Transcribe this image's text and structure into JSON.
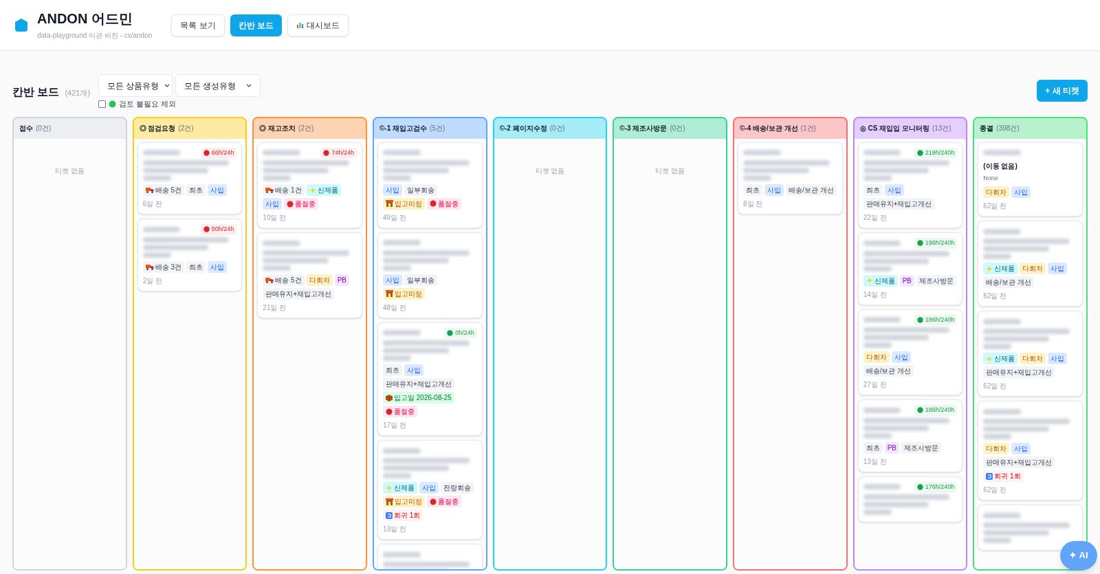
{
  "app": {
    "title": "ANDON 어드민",
    "subtitle": "data-playground 이관 버전 - cx/andon"
  },
  "nav": [
    {
      "label": "목록 보기",
      "selected": false,
      "kind": "list"
    },
    {
      "label": "칸반 보드",
      "selected": true,
      "kind": "board"
    },
    {
      "label": "대시보드",
      "selected": false,
      "kind": "dashboard"
    }
  ],
  "toolbar": {
    "title": "칸반 보드",
    "count": "(421개)",
    "filters": [
      "모든 상품유형",
      "모든 생성유형"
    ],
    "exclude": {
      "label": "검토 불필요 제외",
      "checked": false
    },
    "new_button": "+ 새 티켓"
  },
  "columns": [
    {
      "title": "접수",
      "count": "(0건)",
      "color": "#d1d5db",
      "empty": "티켓 없음"
    },
    {
      "title": "◎ 점검요청",
      "count": "(2건)",
      "color": "#facc15",
      "cards": [
        {
          "kind": "ticket",
          "sla": {
            "text": "66h/24h",
            "color": "#dc2626"
          },
          "tags": [
            {
              "text": "배송 5건",
              "kind": "delivery"
            },
            {
              "text": "최초",
              "kind": "plain"
            },
            {
              "text": "사입",
              "kind": "purchase"
            }
          ],
          "age": "6일 전"
        },
        {
          "kind": "ticket",
          "sla": {
            "text": "50h/24h",
            "color": "#dc2626"
          },
          "tags": [
            {
              "text": "배송 3건",
              "kind": "delivery"
            },
            {
              "text": "최초",
              "kind": "plain"
            },
            {
              "text": "사입",
              "kind": "purchase"
            }
          ],
          "age": "2일 전"
        }
      ]
    },
    {
      "title": "◎ 재고조치",
      "count": "(2건)",
      "color": "#fb923c",
      "cards": [
        {
          "kind": "ticket",
          "sla": {
            "text": "74h/24h",
            "color": "#dc2626"
          },
          "tags": [
            {
              "text": "배송 1건",
              "kind": "delivery"
            },
            {
              "text": "신제품",
              "kind": "new"
            },
            {
              "text": "사입",
              "kind": "purchase"
            },
            {
              "text": "품절중",
              "kind": "soldout"
            }
          ],
          "age": "10일 전"
        },
        {
          "kind": "ticket",
          "tags": [
            {
              "text": "배송 5건",
              "kind": "delivery"
            },
            {
              "text": "다회차",
              "kind": "multi"
            },
            {
              "text": "PB",
              "kind": "pb"
            },
            {
              "text": "판매유지+재입고개선",
              "kind": "plain"
            }
          ],
          "age": "21일 전"
        }
      ]
    },
    {
      "title": "©-1 재입고검수",
      "count": "(5건)",
      "color": "#60a5fa",
      "cards": [
        {
          "kind": "ticket",
          "tags": [
            {
              "text": "사입",
              "kind": "purchase"
            },
            {
              "text": "일부회송",
              "kind": "plain"
            },
            {
              "text": "입고미정",
              "kind": "pending"
            },
            {
              "text": "품절중",
              "kind": "soldout"
            }
          ],
          "age": "49일 전"
        },
        {
          "kind": "ticket",
          "tags": [
            {
              "text": "사입",
              "kind": "purchase"
            },
            {
              "text": "일부회송",
              "kind": "plain"
            },
            {
              "text": "입고미정",
              "kind": "pending"
            }
          ],
          "age": "48일 전"
        },
        {
          "kind": "ticket",
          "sla": {
            "text": "0h/24h",
            "color": "#16a34a"
          },
          "tags": [
            {
              "text": "최초",
              "kind": "plain"
            },
            {
              "text": "사입",
              "kind": "purchase"
            },
            {
              "text": "판매유지+재입고개선",
              "kind": "plain"
            },
            {
              "text": "입고일 2026-08-25",
              "kind": "arrival"
            },
            {
              "text": "품절중",
              "kind": "soldout"
            }
          ],
          "age": "17일 전"
        },
        {
          "kind": "ticket",
          "tags": [
            {
              "text": "신제품",
              "kind": "new"
            },
            {
              "text": "사입",
              "kind": "purchase"
            },
            {
              "text": "전량회송",
              "kind": "plain"
            },
            {
              "text": "입고미정",
              "kind": "pending"
            },
            {
              "text": "품절중",
              "kind": "soldout"
            },
            {
              "text": "회귀 1회",
              "kind": "regression"
            }
          ],
          "age": "13일 전"
        },
        {
          "kind": "ticket"
        }
      ]
    },
    {
      "title": "©-2 페이지수정",
      "count": "(0건)",
      "color": "#22d3ee",
      "empty": "티켓 없음"
    },
    {
      "title": "©-3 제조사방문",
      "count": "(0건)",
      "color": "#34d399",
      "empty": "티켓 없음"
    },
    {
      "title": "©-4 배송/보관 개선",
      "count": "(1건)",
      "color": "#f87171",
      "cards": [
        {
          "kind": "ticket",
          "tags": [
            {
              "text": "최초",
              "kind": "plain"
            },
            {
              "text": "사입",
              "kind": "purchase"
            },
            {
              "text": "배송/보관 개선",
              "kind": "plain"
            }
          ],
          "age": "8일 전"
        }
      ]
    },
    {
      "title": "◎ CS 재입입 모니터링",
      "count": "(13건)",
      "color": "#c084fc",
      "cards": [
        {
          "kind": "ticket",
          "sla": {
            "text": "219h/240h",
            "color": "#16a34a"
          },
          "tags": [
            {
              "text": "최초",
              "kind": "plain"
            },
            {
              "text": "사입",
              "kind": "purchase"
            },
            {
              "text": "판매유지+재입고개선",
              "kind": "plain"
            }
          ],
          "age": "22일 전"
        },
        {
          "kind": "ticket",
          "sla": {
            "text": "196h/240h",
            "color": "#16a34a"
          },
          "tags": [
            {
              "text": "신제품",
              "kind": "new"
            },
            {
              "text": "PB",
              "kind": "pb"
            },
            {
              "text": "제조사방문",
              "kind": "plain"
            }
          ],
          "age": "14일 전"
        },
        {
          "kind": "ticket",
          "sla": {
            "text": "186h/240h",
            "color": "#16a34a"
          },
          "tags": [
            {
              "text": "다회차",
              "kind": "multi"
            },
            {
              "text": "사입",
              "kind": "purchase"
            },
            {
              "text": "배송/보관 개선",
              "kind": "plain"
            }
          ],
          "age": "27일 전"
        },
        {
          "kind": "ticket",
          "sla": {
            "text": "186h/240h",
            "color": "#16a34a"
          },
          "tags": [
            {
              "text": "최초",
              "kind": "plain"
            },
            {
              "text": "PB",
              "kind": "pb"
            },
            {
              "text": "제조사방문",
              "kind": "plain"
            }
          ],
          "age": "13일 전"
        },
        {
          "kind": "ticket",
          "sla": {
            "text": "176h/240h",
            "color": "#16a34a"
          }
        }
      ]
    },
    {
      "title": "종결",
      "count": "(398건)",
      "color": "#4ade80",
      "cards": [
        {
          "kind": "note",
          "title": "(이동 없음)",
          "subtitle": "None",
          "tags": [
            {
              "text": "다회차",
              "kind": "multi"
            },
            {
              "text": "사입",
              "kind": "purchase"
            }
          ],
          "age": "62일 전"
        },
        {
          "kind": "ticket",
          "tags": [
            {
              "text": "신제품",
              "kind": "new"
            },
            {
              "text": "다회차",
              "kind": "multi"
            },
            {
              "text": "사입",
              "kind": "purchase"
            },
            {
              "text": "배송/보관 개선",
              "kind": "plain"
            }
          ],
          "age": "62일 전"
        },
        {
          "kind": "ticket",
          "tags": [
            {
              "text": "신제품",
              "kind": "new"
            },
            {
              "text": "다회차",
              "kind": "multi"
            },
            {
              "text": "사입",
              "kind": "purchase"
            },
            {
              "text": "판매유지+재입고개선",
              "kind": "plain"
            }
          ],
          "age": "62일 전"
        },
        {
          "kind": "ticket",
          "tags": [
            {
              "text": "다회차",
              "kind": "multi"
            },
            {
              "text": "사입",
              "kind": "purchase"
            },
            {
              "text": "판매유지+재입고개선",
              "kind": "plain"
            },
            {
              "text": "회귀 1회",
              "kind": "regression"
            }
          ],
          "age": "62일 전"
        },
        {
          "kind": "ticket"
        }
      ]
    }
  ],
  "ai_button": "✦ AI"
}
